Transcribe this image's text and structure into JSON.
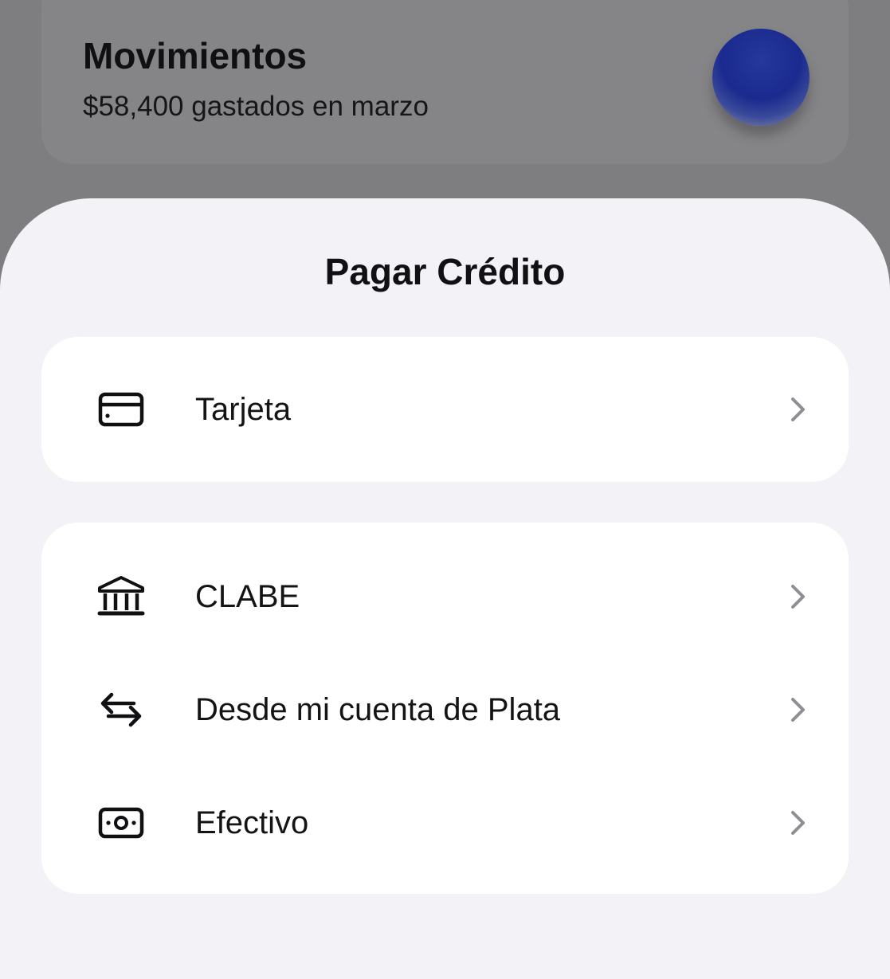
{
  "background": {
    "title": "Movimientos",
    "subtitle": "$58,400 gastados en marzo"
  },
  "sheet": {
    "title": "Pagar Crédito",
    "groups": [
      {
        "items": [
          {
            "label": "Tarjeta",
            "icon": "credit-card-icon"
          }
        ]
      },
      {
        "items": [
          {
            "label": "CLABE",
            "icon": "bank-icon"
          },
          {
            "label": "Desde mi cuenta de Plata",
            "icon": "transfer-arrows-icon"
          },
          {
            "label": "Efectivo",
            "icon": "cash-icon"
          }
        ]
      }
    ]
  },
  "colors": {
    "sheet_background": "#f2f2f7",
    "card_background": "#ffffff",
    "overlay": "#7e7e80",
    "orb": "#1a2a8e",
    "chevron": "#8e8e93"
  }
}
